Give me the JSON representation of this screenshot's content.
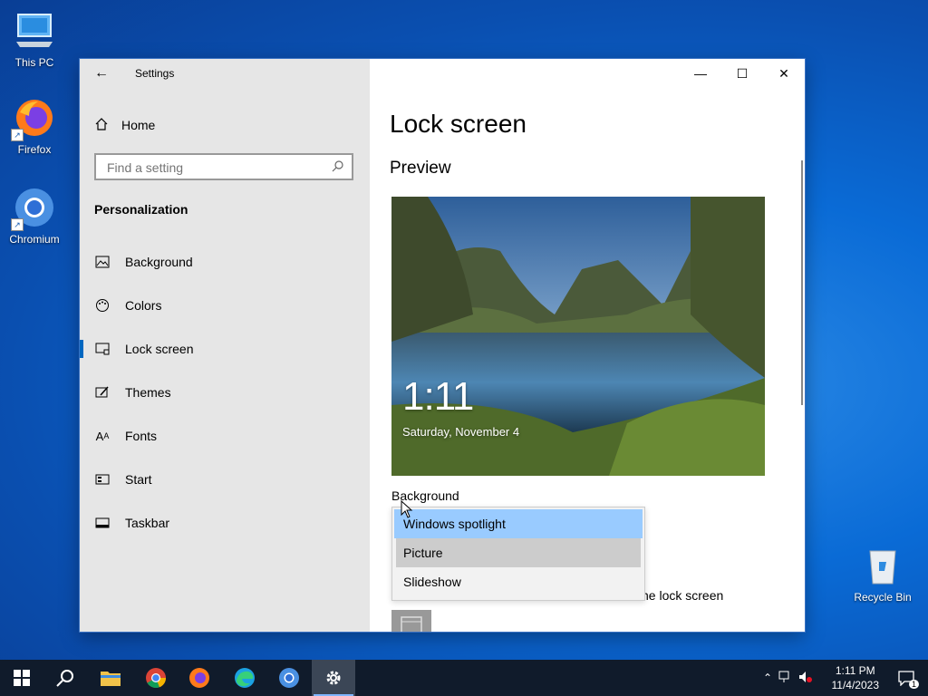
{
  "desktop": {
    "icons": [
      {
        "label": "This PC"
      },
      {
        "label": "Firefox"
      },
      {
        "label": "Chromium"
      },
      {
        "label": "Recycle Bin"
      }
    ]
  },
  "window": {
    "app_title": "Settings",
    "home_label": "Home",
    "search_placeholder": "Find a setting",
    "section_label": "Personalization",
    "nav_items": [
      {
        "label": "Background",
        "icon": "image-icon"
      },
      {
        "label": "Colors",
        "icon": "palette-icon"
      },
      {
        "label": "Lock screen",
        "icon": "lock-screen-icon",
        "active": true
      },
      {
        "label": "Themes",
        "icon": "themes-icon"
      },
      {
        "label": "Fonts",
        "icon": "fonts-icon"
      },
      {
        "label": "Start",
        "icon": "start-icon"
      },
      {
        "label": "Taskbar",
        "icon": "taskbar-icon"
      }
    ],
    "controls": {
      "minimize": "—",
      "maximize": "☐",
      "close": "✕"
    }
  },
  "content": {
    "page_title": "Lock screen",
    "preview_heading": "Preview",
    "preview_time": "1:11",
    "preview_date": "Saturday, November 4",
    "background_label": "Background",
    "dropdown_options": [
      "Windows spotlight",
      "Picture",
      "Slideshow"
    ],
    "dropdown_selected": "Windows spotlight",
    "dropdown_hover": "Picture",
    "partial_text": "ne lock screen"
  },
  "taskbar": {
    "clock_time": "1:11 PM",
    "clock_date": "11/4/2023",
    "notification_count": "1"
  },
  "colors": {
    "accent": "#0067c0",
    "selection": "#99cbff",
    "taskbar": "#101b2b"
  }
}
